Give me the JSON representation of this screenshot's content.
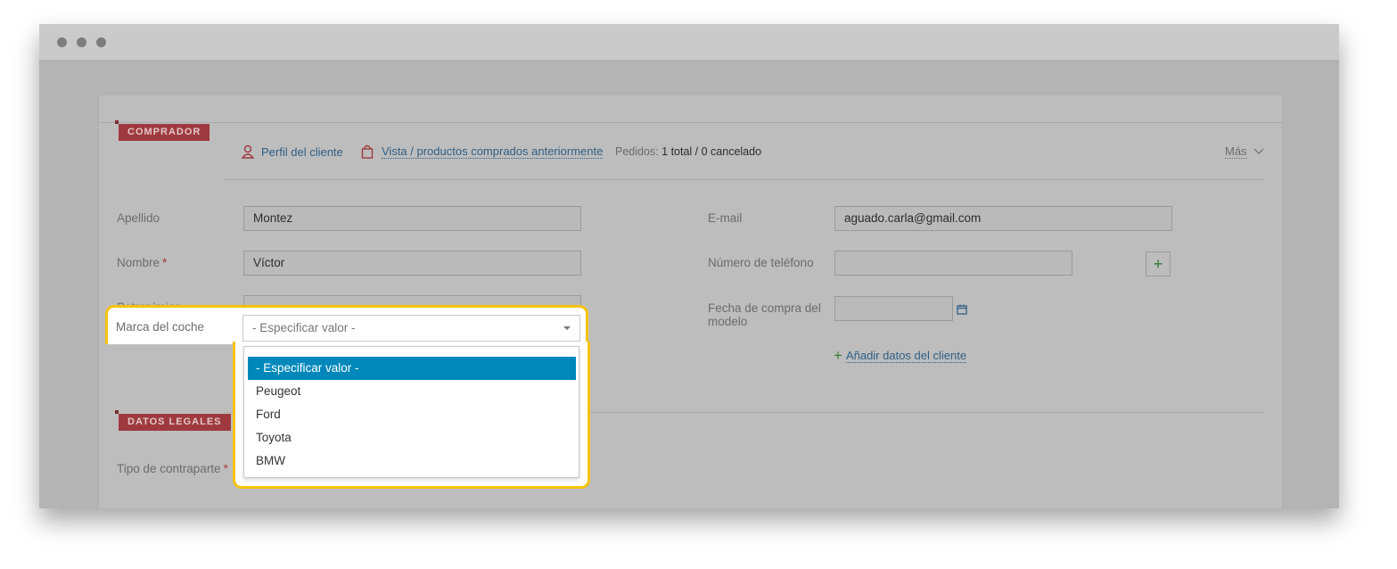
{
  "window": {
    "controls": [
      "close-dot",
      "minimize-dot",
      "maximize-dot"
    ]
  },
  "buyer": {
    "ribbon": "COMPRADOR",
    "profile_link": "Perfil del cliente",
    "purchases_link": "Vista / productos comprados anteriormente",
    "orders_label": "Pedidos:",
    "orders_value": "1 total / 0 cancelado",
    "more_label": "Más"
  },
  "form": {
    "apellido_label": "Apellido",
    "apellido_value": "Montez",
    "nombre_label": "Nombre",
    "nombre_value": "Víctor",
    "required_mark": "*",
    "patronimico_label": "Patronímico",
    "patronimico_value": "",
    "email_label": "E-mail",
    "email_value": "aguado.carla@gmail.com",
    "phone_label": "Número de teléfono",
    "phone_value": "",
    "add_phone_symbol": "+",
    "purchase_date_label_1": "Fecha de compra del",
    "purchase_date_label_2": "modelo",
    "purchase_date_value": "",
    "add_client_data_symbol": "+",
    "add_client_data_link": "Añadir datos del cliente",
    "car_brand_label": "Marca del coche",
    "car_brand_placeholder": "- Especificar valor -"
  },
  "car_brand_options": [
    "- Especificar valor -",
    "Peugeot",
    "Ford",
    "Toyota",
    "BMW"
  ],
  "legal": {
    "ribbon": "DATOS LEGALES",
    "counterparty_label": "Tipo de contraparte"
  },
  "colors": {
    "highlight": "#f4c30f",
    "selected_option": "#0088bb",
    "ribbon": "#9e3a3f",
    "link": "#2f5f86"
  }
}
